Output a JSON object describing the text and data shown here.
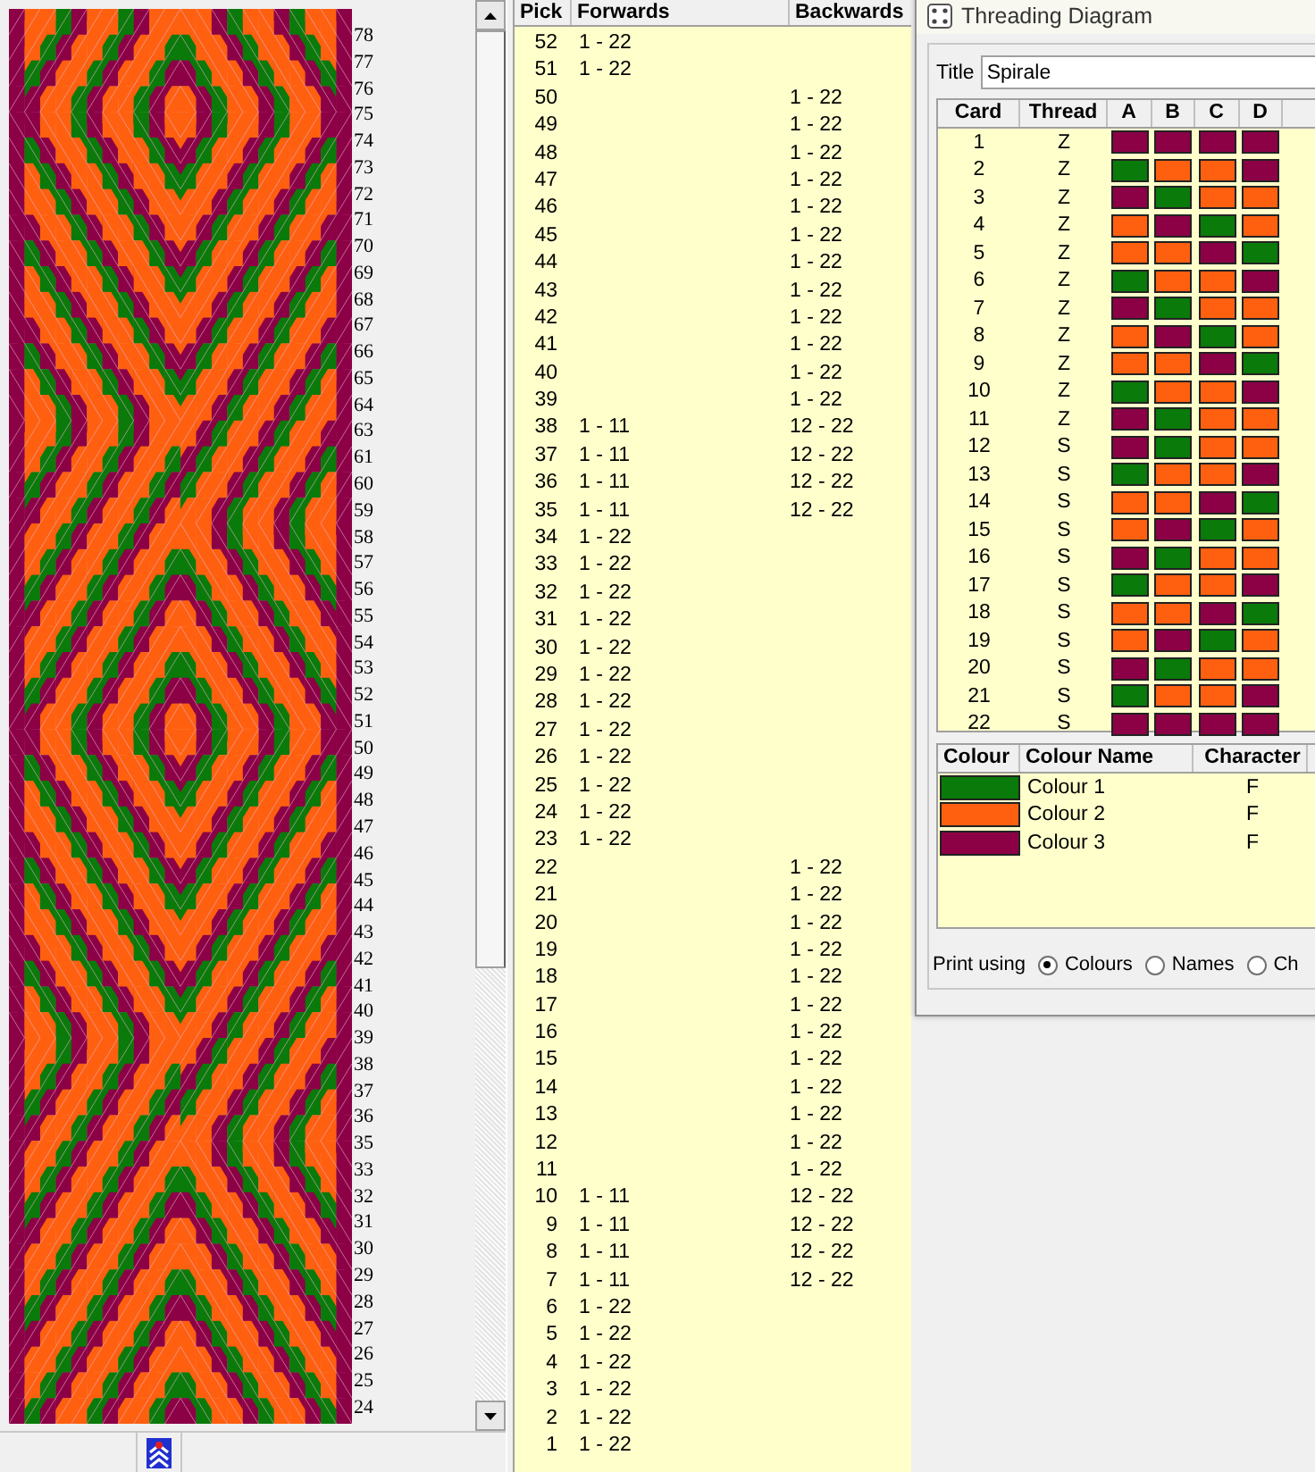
{
  "pattern_view": {
    "row_labels": [
      "78",
      "77",
      "76",
      "75",
      "74",
      "73",
      "72",
      "71",
      "70",
      "69",
      "68",
      "67",
      "66",
      "65",
      "64",
      "63",
      "61",
      "60",
      "59",
      "58",
      "57",
      "56",
      "55",
      "54",
      "53",
      "52",
      "51",
      "50",
      "49",
      "48",
      "47",
      "46",
      "45",
      "44",
      "43",
      "42",
      "41",
      "40",
      "39",
      "38",
      "37",
      "36",
      "35",
      "33",
      "32",
      "31",
      "30",
      "29",
      "28",
      "27",
      "26",
      "25",
      "24"
    ]
  },
  "pick_table": {
    "columns": [
      "Pick",
      "Forwards",
      "Backwards"
    ],
    "rows": [
      {
        "pick": "52",
        "forwards": "1 - 22"
      },
      {
        "pick": "51",
        "forwards": "1 - 22"
      },
      {
        "pick": "50",
        "backwards": "1 - 22"
      },
      {
        "pick": "49",
        "backwards": "1 - 22"
      },
      {
        "pick": "48",
        "backwards": "1 - 22"
      },
      {
        "pick": "47",
        "backwards": "1 - 22"
      },
      {
        "pick": "46",
        "backwards": "1 - 22"
      },
      {
        "pick": "45",
        "backwards": "1 - 22"
      },
      {
        "pick": "44",
        "backwards": "1 - 22"
      },
      {
        "pick": "43",
        "backwards": "1 - 22"
      },
      {
        "pick": "42",
        "backwards": "1 - 22"
      },
      {
        "pick": "41",
        "backwards": "1 - 22"
      },
      {
        "pick": "40",
        "backwards": "1 - 22"
      },
      {
        "pick": "39",
        "backwards": "1 - 22"
      },
      {
        "pick": "38",
        "forwards": "1 - 11",
        "backwards": "12 - 22"
      },
      {
        "pick": "37",
        "forwards": "1 - 11",
        "backwards": "12 - 22"
      },
      {
        "pick": "36",
        "forwards": "1 - 11",
        "backwards": "12 - 22"
      },
      {
        "pick": "35",
        "forwards": "1 - 11",
        "backwards": "12 - 22"
      },
      {
        "pick": "34",
        "forwards": "1 - 22"
      },
      {
        "pick": "33",
        "forwards": "1 - 22"
      },
      {
        "pick": "32",
        "forwards": "1 - 22"
      },
      {
        "pick": "31",
        "forwards": "1 - 22"
      },
      {
        "pick": "30",
        "forwards": "1 - 22"
      },
      {
        "pick": "29",
        "forwards": "1 - 22"
      },
      {
        "pick": "28",
        "forwards": "1 - 22"
      },
      {
        "pick": "27",
        "forwards": "1 - 22"
      },
      {
        "pick": "26",
        "forwards": "1 - 22"
      },
      {
        "pick": "25",
        "forwards": "1 - 22"
      },
      {
        "pick": "24",
        "forwards": "1 - 22"
      },
      {
        "pick": "23",
        "forwards": "1 - 22"
      },
      {
        "pick": "22",
        "backwards": "1 - 22"
      },
      {
        "pick": "21",
        "backwards": "1 - 22"
      },
      {
        "pick": "20",
        "backwards": "1 - 22"
      },
      {
        "pick": "19",
        "backwards": "1 - 22"
      },
      {
        "pick": "18",
        "backwards": "1 - 22"
      },
      {
        "pick": "17",
        "backwards": "1 - 22"
      },
      {
        "pick": "16",
        "backwards": "1 - 22"
      },
      {
        "pick": "15",
        "backwards": "1 - 22"
      },
      {
        "pick": "14",
        "backwards": "1 - 22"
      },
      {
        "pick": "13",
        "backwards": "1 - 22"
      },
      {
        "pick": "12",
        "backwards": "1 - 22"
      },
      {
        "pick": "11",
        "backwards": "1 - 22"
      },
      {
        "pick": "10",
        "forwards": "1 - 11",
        "backwards": "12 - 22"
      },
      {
        "pick": "9",
        "forwards": "1 - 11",
        "backwards": "12 - 22"
      },
      {
        "pick": "8",
        "forwards": "1 - 11",
        "backwards": "12 - 22"
      },
      {
        "pick": "7",
        "forwards": "1 - 11",
        "backwards": "12 - 22"
      },
      {
        "pick": "6",
        "forwards": "1 - 22"
      },
      {
        "pick": "5",
        "forwards": "1 - 22"
      },
      {
        "pick": "4",
        "forwards": "1 - 22"
      },
      {
        "pick": "3",
        "forwards": "1 - 22"
      },
      {
        "pick": "2",
        "forwards": "1 - 22"
      },
      {
        "pick": "1",
        "forwards": "1 - 22"
      }
    ]
  },
  "threading_window": {
    "title": "Threading Diagram",
    "title_label": "Title",
    "title_value": "Spirale",
    "card_columns": [
      "Card",
      "Thread",
      "A",
      "B",
      "C",
      "D"
    ],
    "cards": [
      {
        "card": "1",
        "thread": "Z",
        "holes": [
          {
            "color": "#8c0046"
          },
          {
            "color": "#8c0046"
          },
          {
            "color": "#8c0046"
          },
          {
            "color": "#8c0046"
          }
        ]
      },
      {
        "card": "2",
        "thread": "Z",
        "holes": [
          {
            "color": "#0a7a0a"
          },
          {
            "color": "#ff6010"
          },
          {
            "color": "#ff6010"
          },
          {
            "color": "#8c0046"
          }
        ]
      },
      {
        "card": "3",
        "thread": "Z",
        "holes": [
          {
            "color": "#8c0046"
          },
          {
            "color": "#0a7a0a"
          },
          {
            "color": "#ff6010"
          },
          {
            "color": "#ff6010"
          }
        ]
      },
      {
        "card": "4",
        "thread": "Z",
        "holes": [
          {
            "color": "#ff6010"
          },
          {
            "color": "#8c0046"
          },
          {
            "color": "#0a7a0a"
          },
          {
            "color": "#ff6010"
          }
        ]
      },
      {
        "card": "5",
        "thread": "Z",
        "holes": [
          {
            "color": "#ff6010"
          },
          {
            "color": "#ff6010"
          },
          {
            "color": "#8c0046"
          },
          {
            "color": "#0a7a0a"
          }
        ]
      },
      {
        "card": "6",
        "thread": "Z",
        "holes": [
          {
            "color": "#0a7a0a"
          },
          {
            "color": "#ff6010"
          },
          {
            "color": "#ff6010"
          },
          {
            "color": "#8c0046"
          }
        ]
      },
      {
        "card": "7",
        "thread": "Z",
        "holes": [
          {
            "color": "#8c0046"
          },
          {
            "color": "#0a7a0a"
          },
          {
            "color": "#ff6010"
          },
          {
            "color": "#ff6010"
          }
        ]
      },
      {
        "card": "8",
        "thread": "Z",
        "holes": [
          {
            "color": "#ff6010"
          },
          {
            "color": "#8c0046"
          },
          {
            "color": "#0a7a0a"
          },
          {
            "color": "#ff6010"
          }
        ]
      },
      {
        "card": "9",
        "thread": "Z",
        "holes": [
          {
            "color": "#ff6010"
          },
          {
            "color": "#ff6010"
          },
          {
            "color": "#8c0046"
          },
          {
            "color": "#0a7a0a"
          }
        ]
      },
      {
        "card": "10",
        "thread": "Z",
        "holes": [
          {
            "color": "#0a7a0a"
          },
          {
            "color": "#ff6010"
          },
          {
            "color": "#ff6010"
          },
          {
            "color": "#8c0046"
          }
        ]
      },
      {
        "card": "11",
        "thread": "Z",
        "holes": [
          {
            "color": "#8c0046"
          },
          {
            "color": "#0a7a0a"
          },
          {
            "color": "#ff6010"
          },
          {
            "color": "#ff6010"
          }
        ]
      },
      {
        "card": "12",
        "thread": "S",
        "holes": [
          {
            "color": "#8c0046"
          },
          {
            "color": "#0a7a0a"
          },
          {
            "color": "#ff6010"
          },
          {
            "color": "#ff6010"
          }
        ]
      },
      {
        "card": "13",
        "thread": "S",
        "holes": [
          {
            "color": "#0a7a0a"
          },
          {
            "color": "#ff6010"
          },
          {
            "color": "#ff6010"
          },
          {
            "color": "#8c0046"
          }
        ]
      },
      {
        "card": "14",
        "thread": "S",
        "holes": [
          {
            "color": "#ff6010"
          },
          {
            "color": "#ff6010"
          },
          {
            "color": "#8c0046"
          },
          {
            "color": "#0a7a0a"
          }
        ]
      },
      {
        "card": "15",
        "thread": "S",
        "holes": [
          {
            "color": "#ff6010"
          },
          {
            "color": "#8c0046"
          },
          {
            "color": "#0a7a0a"
          },
          {
            "color": "#ff6010"
          }
        ]
      },
      {
        "card": "16",
        "thread": "S",
        "holes": [
          {
            "color": "#8c0046"
          },
          {
            "color": "#0a7a0a"
          },
          {
            "color": "#ff6010"
          },
          {
            "color": "#ff6010"
          }
        ]
      },
      {
        "card": "17",
        "thread": "S",
        "holes": [
          {
            "color": "#0a7a0a"
          },
          {
            "color": "#ff6010"
          },
          {
            "color": "#ff6010"
          },
          {
            "color": "#8c0046"
          }
        ]
      },
      {
        "card": "18",
        "thread": "S",
        "holes": [
          {
            "color": "#ff6010"
          },
          {
            "color": "#ff6010"
          },
          {
            "color": "#8c0046"
          },
          {
            "color": "#0a7a0a"
          }
        ]
      },
      {
        "card": "19",
        "thread": "S",
        "holes": [
          {
            "color": "#ff6010"
          },
          {
            "color": "#8c0046"
          },
          {
            "color": "#0a7a0a"
          },
          {
            "color": "#ff6010"
          }
        ]
      },
      {
        "card": "20",
        "thread": "S",
        "holes": [
          {
            "color": "#8c0046"
          },
          {
            "color": "#0a7a0a"
          },
          {
            "color": "#ff6010"
          },
          {
            "color": "#ff6010"
          }
        ]
      },
      {
        "card": "21",
        "thread": "S",
        "holes": [
          {
            "color": "#0a7a0a"
          },
          {
            "color": "#ff6010"
          },
          {
            "color": "#ff6010"
          },
          {
            "color": "#8c0046"
          }
        ]
      },
      {
        "card": "22",
        "thread": "S",
        "holes": [
          {
            "color": "#8c0046"
          },
          {
            "color": "#8c0046"
          },
          {
            "color": "#8c0046"
          },
          {
            "color": "#8c0046"
          }
        ]
      }
    ],
    "colour_columns": [
      "Colour",
      "Colour Name",
      "Character"
    ],
    "colours": [
      {
        "color": "#0a7a0a",
        "name": "Colour 1",
        "character": "F"
      },
      {
        "color": "#ff6010",
        "name": "Colour 2",
        "character": "F"
      },
      {
        "color": "#8c0046",
        "name": "Colour 3",
        "character": "F"
      }
    ],
    "print_using": {
      "label": "Print using",
      "options": [
        {
          "label": "Colours",
          "selected": true
        },
        {
          "label": "Names",
          "selected": false
        },
        {
          "label": "Ch",
          "selected": false
        }
      ]
    }
  }
}
